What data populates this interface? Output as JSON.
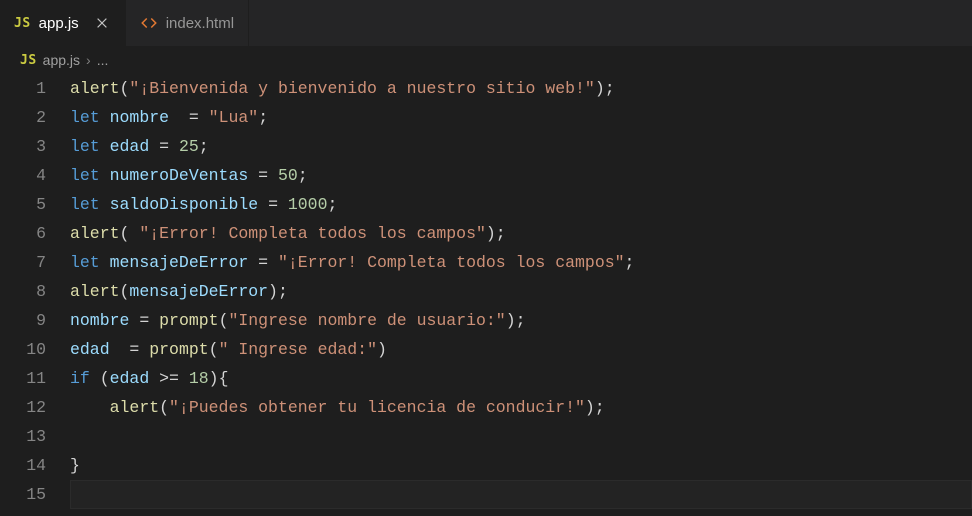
{
  "tabs": {
    "active": {
      "icon": "js",
      "label": "app.js"
    },
    "inactive": {
      "icon": "html",
      "label": "index.html"
    }
  },
  "breadcrumb": {
    "icon": "js",
    "file": "app.js",
    "rest": "..."
  },
  "code": {
    "line_numbers": [
      "1",
      "2",
      "3",
      "4",
      "5",
      "6",
      "7",
      "8",
      "9",
      "10",
      "11",
      "12",
      "13",
      "14",
      "15"
    ],
    "lines": [
      [
        {
          "c": "t-fn",
          "t": "alert"
        },
        {
          "c": "t-punc",
          "t": "("
        },
        {
          "c": "t-str",
          "t": "\"¡Bienvenida y bienvenido a nuestro sitio web!\""
        },
        {
          "c": "t-punc",
          "t": ");"
        }
      ],
      [
        {
          "c": "t-kw",
          "t": "let"
        },
        {
          "c": "",
          "t": " "
        },
        {
          "c": "t-var",
          "t": "nombre"
        },
        {
          "c": "",
          "t": "  "
        },
        {
          "c": "t-punc",
          "t": "="
        },
        {
          "c": "",
          "t": " "
        },
        {
          "c": "t-str",
          "t": "\"Lua\""
        },
        {
          "c": "t-punc",
          "t": ";"
        }
      ],
      [
        {
          "c": "t-kw",
          "t": "let"
        },
        {
          "c": "",
          "t": " "
        },
        {
          "c": "t-var",
          "t": "edad"
        },
        {
          "c": "",
          "t": " "
        },
        {
          "c": "t-punc",
          "t": "="
        },
        {
          "c": "",
          "t": " "
        },
        {
          "c": "t-num",
          "t": "25"
        },
        {
          "c": "t-punc",
          "t": ";"
        }
      ],
      [
        {
          "c": "t-kw",
          "t": "let"
        },
        {
          "c": "",
          "t": " "
        },
        {
          "c": "t-var",
          "t": "numeroDeVentas"
        },
        {
          "c": "",
          "t": " "
        },
        {
          "c": "t-punc",
          "t": "="
        },
        {
          "c": "",
          "t": " "
        },
        {
          "c": "t-num",
          "t": "50"
        },
        {
          "c": "t-punc",
          "t": ";"
        }
      ],
      [
        {
          "c": "t-kw",
          "t": "let"
        },
        {
          "c": "",
          "t": " "
        },
        {
          "c": "t-var",
          "t": "saldoDisponible"
        },
        {
          "c": "",
          "t": " "
        },
        {
          "c": "t-punc",
          "t": "="
        },
        {
          "c": "",
          "t": " "
        },
        {
          "c": "t-num",
          "t": "1000"
        },
        {
          "c": "t-punc",
          "t": ";"
        }
      ],
      [
        {
          "c": "t-fn",
          "t": "alert"
        },
        {
          "c": "t-punc",
          "t": "( "
        },
        {
          "c": "t-str",
          "t": "\"¡Error! Completa todos los campos\""
        },
        {
          "c": "t-punc",
          "t": ");"
        }
      ],
      [
        {
          "c": "t-kw",
          "t": "let"
        },
        {
          "c": "",
          "t": " "
        },
        {
          "c": "t-var",
          "t": "mensajeDeError"
        },
        {
          "c": "",
          "t": " "
        },
        {
          "c": "t-punc",
          "t": "="
        },
        {
          "c": "",
          "t": " "
        },
        {
          "c": "t-str",
          "t": "\"¡Error! Completa todos los campos\""
        },
        {
          "c": "t-punc",
          "t": ";"
        }
      ],
      [
        {
          "c": "t-fn",
          "t": "alert"
        },
        {
          "c": "t-punc",
          "t": "("
        },
        {
          "c": "t-var",
          "t": "mensajeDeError"
        },
        {
          "c": "t-punc",
          "t": ");"
        }
      ],
      [
        {
          "c": "t-var",
          "t": "nombre"
        },
        {
          "c": "",
          "t": " "
        },
        {
          "c": "t-punc",
          "t": "="
        },
        {
          "c": "",
          "t": " "
        },
        {
          "c": "t-fn",
          "t": "prompt"
        },
        {
          "c": "t-punc",
          "t": "("
        },
        {
          "c": "t-str",
          "t": "\"Ingrese nombre de usuario:\""
        },
        {
          "c": "t-punc",
          "t": ");"
        }
      ],
      [
        {
          "c": "t-var",
          "t": "edad"
        },
        {
          "c": "",
          "t": "  "
        },
        {
          "c": "t-punc",
          "t": "="
        },
        {
          "c": "",
          "t": " "
        },
        {
          "c": "t-fn",
          "t": "prompt"
        },
        {
          "c": "t-punc",
          "t": "("
        },
        {
          "c": "t-str",
          "t": "\" Ingrese edad:\""
        },
        {
          "c": "t-punc",
          "t": ")"
        }
      ],
      [
        {
          "c": "t-kw",
          "t": "if"
        },
        {
          "c": "",
          "t": " "
        },
        {
          "c": "t-punc",
          "t": "("
        },
        {
          "c": "t-var",
          "t": "edad"
        },
        {
          "c": "",
          "t": " "
        },
        {
          "c": "t-punc",
          "t": ">="
        },
        {
          "c": "",
          "t": " "
        },
        {
          "c": "t-num",
          "t": "18"
        },
        {
          "c": "t-punc",
          "t": "){"
        }
      ],
      [
        {
          "c": "",
          "t": "    "
        },
        {
          "c": "t-fn",
          "t": "alert"
        },
        {
          "c": "t-punc",
          "t": "("
        },
        {
          "c": "t-str",
          "t": "\"¡Puedes obtener tu licencia de conducir!\""
        },
        {
          "c": "t-punc",
          "t": ");"
        }
      ],
      [],
      [
        {
          "c": "t-punc",
          "t": "}"
        }
      ],
      []
    ],
    "highlight_line": 15
  }
}
